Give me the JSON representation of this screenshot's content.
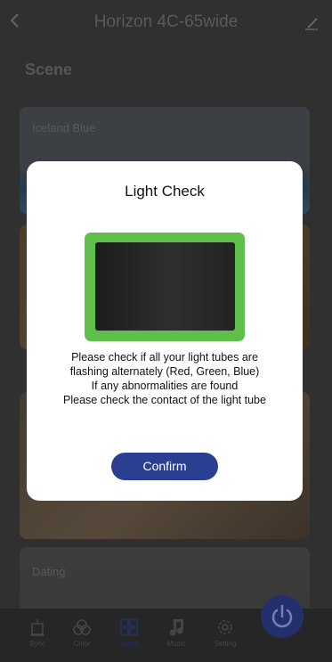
{
  "header": {
    "title": "Horizon 4C-65wide",
    "back_icon": "chevron-left-icon",
    "edit_icon": "pencil-icon"
  },
  "section": {
    "title": "Scene"
  },
  "scenes": [
    {
      "label": "Iceland Blue"
    },
    {
      "label": ""
    },
    {
      "label": ""
    },
    {
      "label": "Dating"
    }
  ],
  "tabs": [
    {
      "label": "Sync",
      "icon": "sync-icon"
    },
    {
      "label": "Color",
      "icon": "color-icon"
    },
    {
      "label": "Scene",
      "icon": "scene-icon"
    },
    {
      "label": "Music",
      "icon": "music-icon"
    },
    {
      "label": "Setting",
      "icon": "gear-icon"
    }
  ],
  "modal": {
    "title": "Light Check",
    "message_lines": [
      "Please check if all your light tubes are",
      "flashing alternately (Red, Green, Blue)",
      "If any abnormalities are found",
      "Please check the contact of the light tube"
    ],
    "confirm_label": "Confirm"
  },
  "colors": {
    "accent": "#2a3f8f",
    "screen_frame": "#5fbf4a"
  }
}
